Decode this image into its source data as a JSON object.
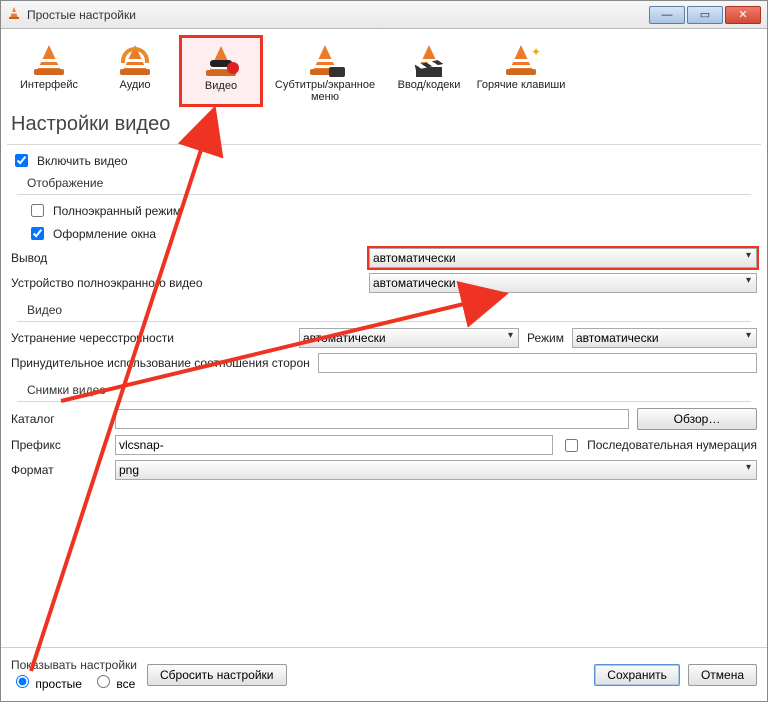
{
  "window": {
    "title": "Простые настройки"
  },
  "categories": [
    {
      "label": "Интерфейс"
    },
    {
      "label": "Аудио"
    },
    {
      "label": "Видео"
    },
    {
      "label": "Субтитры/экранное меню"
    },
    {
      "label": "Ввод/кодеки"
    },
    {
      "label": "Горячие клавиши"
    }
  ],
  "heading": "Настройки видео",
  "enable_video": {
    "label": "Включить видео",
    "checked": true
  },
  "display": {
    "title": "Отображение",
    "fullscreen": {
      "label": "Полноэкранный режим",
      "checked": false
    },
    "window_decoration": {
      "label": "Оформление окна",
      "checked": true
    },
    "output_label": "Вывод",
    "output_value": "автоматически",
    "fs_device_label": "Устройство полноэкранного видео",
    "fs_device_value": "автоматически"
  },
  "video_group": {
    "title": "Видео",
    "deint_label": "Устранение чересстрочности",
    "deint_value": "автоматически",
    "mode_label": "Режим",
    "mode_value": "автоматически",
    "force_ar_label": "Принудительное использование соотношения сторон",
    "force_ar_value": ""
  },
  "snapshots": {
    "title": "Снимки видео",
    "dir_label": "Каталог",
    "dir_value": "",
    "browse_label": "Обзор…",
    "prefix_label": "Префикс",
    "prefix_value": "vlcsnap-",
    "seq_label": "Последовательная нумерация",
    "seq_checked": false,
    "format_label": "Формат",
    "format_value": "png"
  },
  "footer": {
    "show_label": "Показывать настройки",
    "radio_simple": "простые",
    "radio_all": "все",
    "reset": "Сбросить настройки",
    "save": "Сохранить",
    "cancel": "Отмена"
  }
}
